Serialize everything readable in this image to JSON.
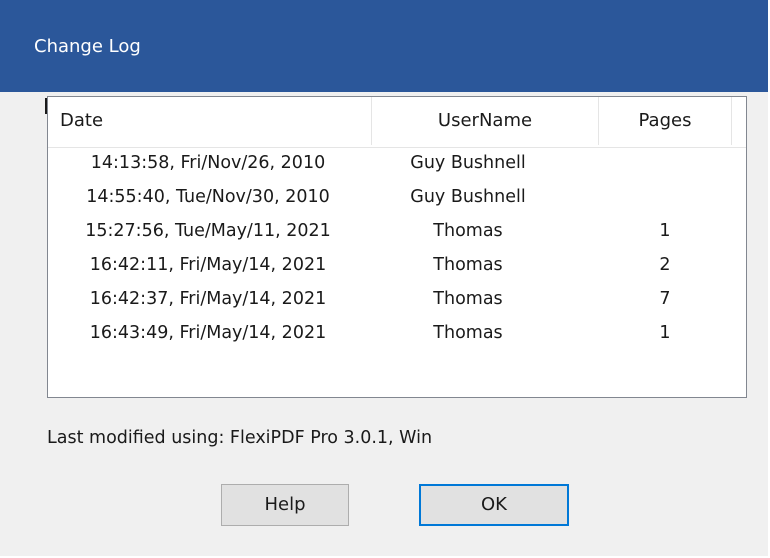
{
  "window": {
    "title": "Change Log"
  },
  "list": {
    "columns": [
      "Date",
      "UserName",
      "Pages"
    ],
    "rows": [
      {
        "date": "14:13:58, Fri/Nov/26, 2010",
        "user": "Guy Bushnell",
        "pages": ""
      },
      {
        "date": "14:55:40, Tue/Nov/30, 2010",
        "user": "Guy Bushnell",
        "pages": ""
      },
      {
        "date": "15:27:56, Tue/May/11, 2021",
        "user": "Thomas",
        "pages": "1"
      },
      {
        "date": "16:42:11, Fri/May/14, 2021",
        "user": "Thomas",
        "pages": "2"
      },
      {
        "date": "16:42:37, Fri/May/14, 2021",
        "user": "Thomas",
        "pages": "7"
      },
      {
        "date": "16:43:49, Fri/May/14, 2021",
        "user": "Thomas",
        "pages": "1"
      }
    ]
  },
  "footer": {
    "last_modified": "Last modified using:   FlexiPDF Pro 3.0.1, Win"
  },
  "buttons": {
    "help": "Help",
    "ok": "OK"
  }
}
